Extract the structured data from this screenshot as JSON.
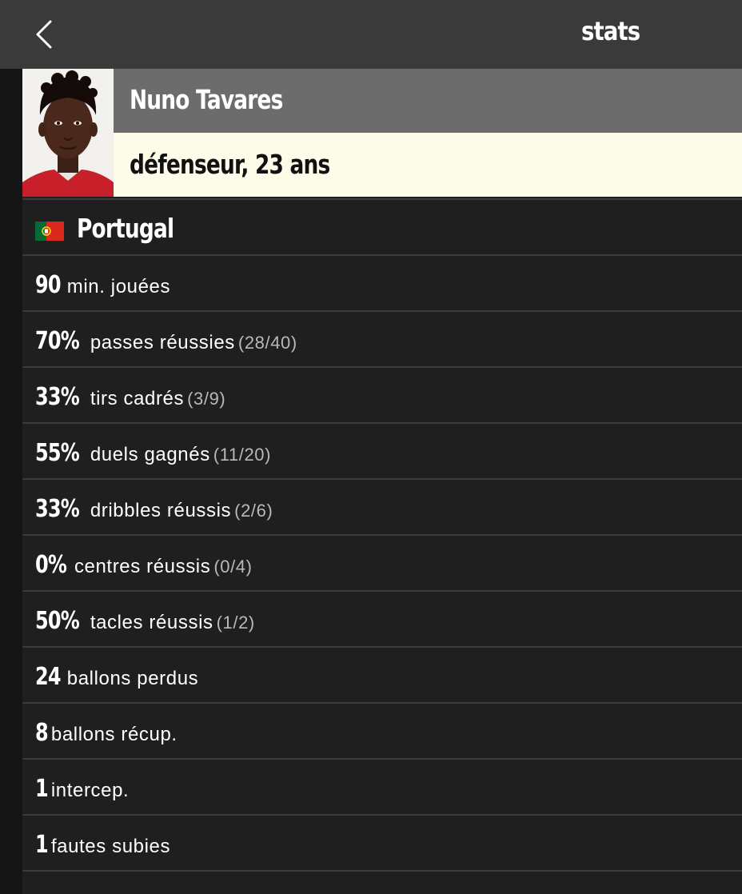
{
  "header": {
    "title": "stats",
    "back_icon": "chevron-left-icon"
  },
  "player": {
    "name": "Nuno Tavares",
    "role": "défenseur, 23 ans",
    "role_bar_color": "#fdfce8",
    "name_bar_color": "#6c6c6c"
  },
  "country": {
    "name": "Portugal",
    "flag_icon": "portugal-flag-icon"
  },
  "stats": [
    {
      "value": "90",
      "label": "min. jouées",
      "detail": ""
    },
    {
      "value": "70%",
      "label": "passes réussies",
      "detail": "(28/40)"
    },
    {
      "value": "33%",
      "label": "tirs cadrés",
      "detail": "(3/9)"
    },
    {
      "value": "55%",
      "label": "duels gagnés",
      "detail": "(11/20)"
    },
    {
      "value": "33%",
      "label": "dribbles réussis",
      "detail": "(2/6)"
    },
    {
      "value": "0%",
      "label": "centres réussis",
      "detail": "(0/4)"
    },
    {
      "value": "50%",
      "label": "tacles réussis",
      "detail": "(1/2)"
    },
    {
      "value": "24",
      "label": "ballons perdus",
      "detail": ""
    },
    {
      "value": "8",
      "label": "ballons récup.",
      "detail": ""
    },
    {
      "value": "1",
      "label": "intercep.",
      "detail": ""
    },
    {
      "value": "1",
      "label": "fautes subies",
      "detail": ""
    }
  ]
}
